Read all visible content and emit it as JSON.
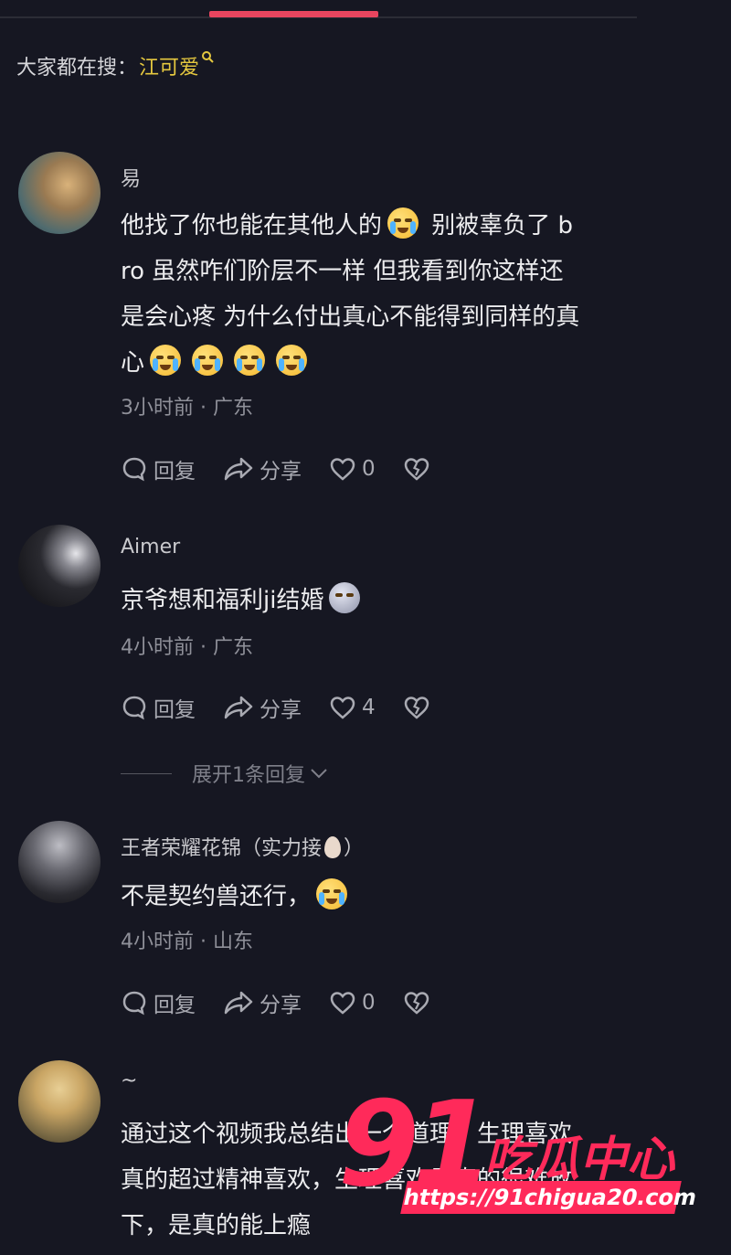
{
  "search_hint": {
    "prefix": "大家都在搜：",
    "keyword": "江可爱"
  },
  "comments": [
    {
      "user": "易",
      "text_lines": [
        "他找了你也能在其他人的",
        " 别被辜负了 b",
        "ro 虽然咋们阶层不一样 但我看到你这样还",
        "是会心疼 为什么付出真心不能得到同样的真",
        "心"
      ],
      "meta": "3小时前 · 广东",
      "reply_label": "回复",
      "share_label": "分享",
      "likes": "0"
    },
    {
      "user": "Aimer",
      "text": "京爷想和福利ji结婚",
      "meta": "4小时前 · 广东",
      "reply_label": "回复",
      "share_label": "分享",
      "likes": "4"
    },
    {
      "user": "王者荣耀花锦（实力接",
      "user_suffix": "）",
      "text": "不是契约兽还行，",
      "meta": "4小时前 · 山东",
      "reply_label": "回复",
      "share_label": "分享",
      "likes": "0"
    },
    {
      "user": "~",
      "text_lines": [
        "通过这个视频我总结出一个道理，生理喜欢",
        "真的超过精神喜欢，生理喜欢是真的很难放",
        "下，是真的能上瘾"
      ]
    }
  ],
  "expand_replies": "展开1条回复",
  "watermark": {
    "number": "91",
    "brand": "吃瓜中心",
    "url": "https://91chigua20.com"
  },
  "colors": {
    "accent": "#e8455f",
    "keyword": "#e5c83f",
    "watermark": "#ff2a5a"
  }
}
